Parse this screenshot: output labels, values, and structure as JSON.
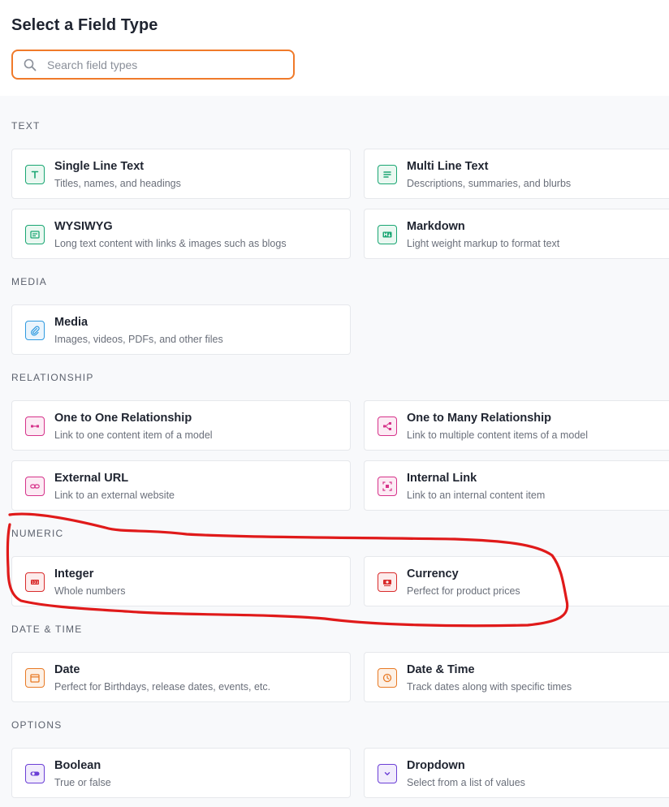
{
  "title": "Select a Field Type",
  "search": {
    "placeholder": "Search field types",
    "value": ""
  },
  "accent_color": "#f07a2a",
  "sections": {
    "text": {
      "label": "TEXT",
      "items": [
        {
          "name": "Single Line Text",
          "desc": "Titles, names, and headings",
          "icon": "text-t-icon"
        },
        {
          "name": "Multi Line Text",
          "desc": "Descriptions, summaries, and blurbs",
          "icon": "paragraph-icon"
        },
        {
          "name": "WYSIWYG",
          "desc": "Long text content with links & images such as blogs",
          "icon": "editor-icon"
        },
        {
          "name": "Markdown",
          "desc": "Light weight markup to format text",
          "icon": "markdown-icon"
        }
      ]
    },
    "media": {
      "label": "MEDIA",
      "items": [
        {
          "name": "Media",
          "desc": "Images, videos, PDFs, and other files",
          "icon": "paperclip-icon"
        }
      ]
    },
    "relationship": {
      "label": "RELATIONSHIP",
      "items": [
        {
          "name": "One to One Relationship",
          "desc": "Link to one content item of a model",
          "icon": "one-to-one-icon"
        },
        {
          "name": "One to Many Relationship",
          "desc": "Link to multiple content items of a model",
          "icon": "one-to-many-icon"
        },
        {
          "name": "External URL",
          "desc": "Link to an external website",
          "icon": "link-icon"
        },
        {
          "name": "Internal Link",
          "desc": "Link to an internal content item",
          "icon": "internal-link-icon"
        }
      ]
    },
    "numeric": {
      "label": "NUMERIC",
      "items": [
        {
          "name": "Integer",
          "desc": "Whole numbers",
          "icon": "number-icon"
        },
        {
          "name": "Currency",
          "desc": "Perfect for product prices",
          "icon": "money-icon"
        }
      ]
    },
    "datetime": {
      "label": "DATE & TIME",
      "items": [
        {
          "name": "Date",
          "desc": "Perfect for Birthdays, release dates, events, etc.",
          "icon": "calendar-icon"
        },
        {
          "name": "Date & Time",
          "desc": "Track dates along with specific times",
          "icon": "clock-icon"
        }
      ]
    },
    "options": {
      "label": "OPTIONS",
      "items": [
        {
          "name": "Boolean",
          "desc": "True or false",
          "icon": "toggle-icon"
        },
        {
          "name": "Dropdown",
          "desc": "Select from a list of values",
          "icon": "chevron-down-icon"
        }
      ]
    }
  }
}
